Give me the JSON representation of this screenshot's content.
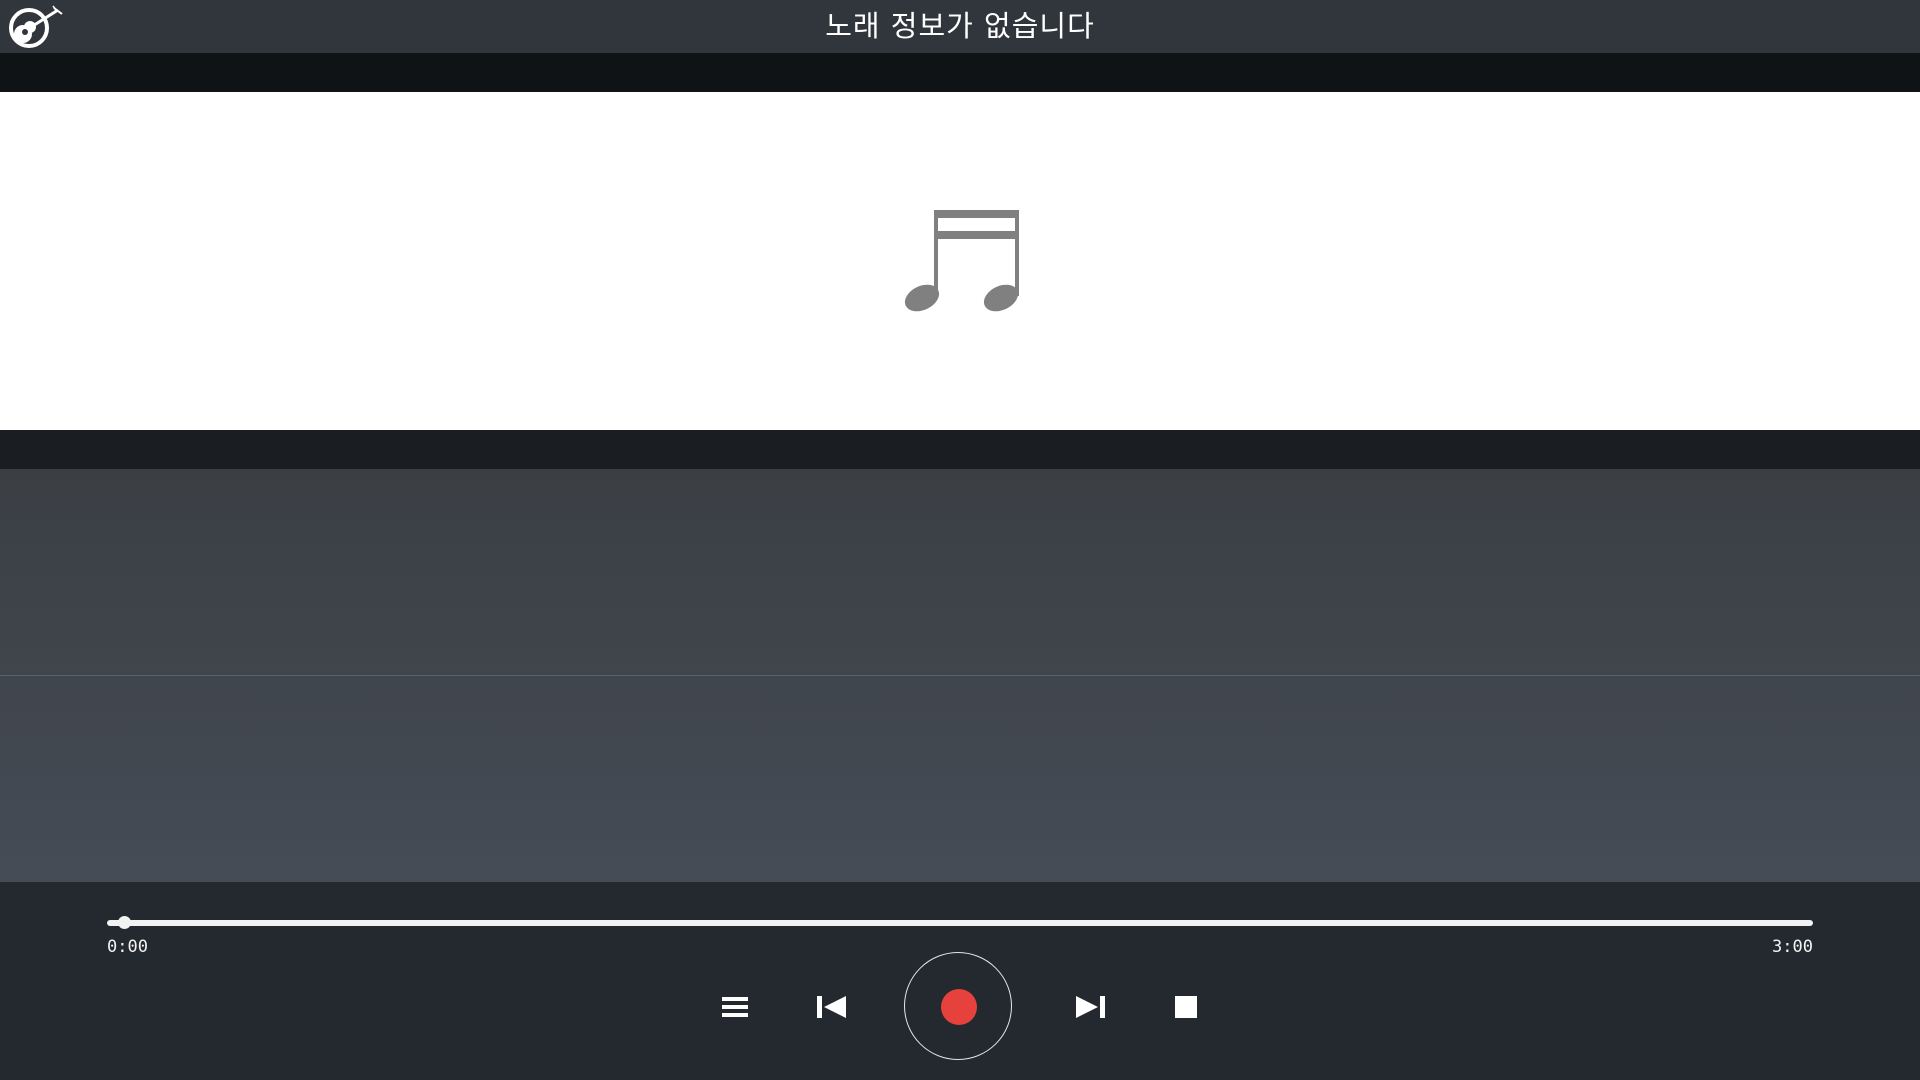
{
  "header": {
    "title": "노래 정보가 없습니다",
    "logo_icon": "guitar-disc-logo-icon"
  },
  "artwork": {
    "placeholder_icon": "music-note-icon",
    "icon_color": "#808080"
  },
  "player": {
    "current_time": "0:00",
    "total_time": "3:00",
    "progress": 0.01,
    "buttons": {
      "playlist_icon": "list-icon",
      "prev_icon": "skip-previous-icon",
      "record_icon": "record-icon",
      "next_icon": "skip-next-icon",
      "stop_icon": "stop-icon"
    },
    "record_color": "#e6413d"
  },
  "colors": {
    "title_bar": "#31363d",
    "panel": "#23292f",
    "artwork_bg": "#ffffff"
  }
}
